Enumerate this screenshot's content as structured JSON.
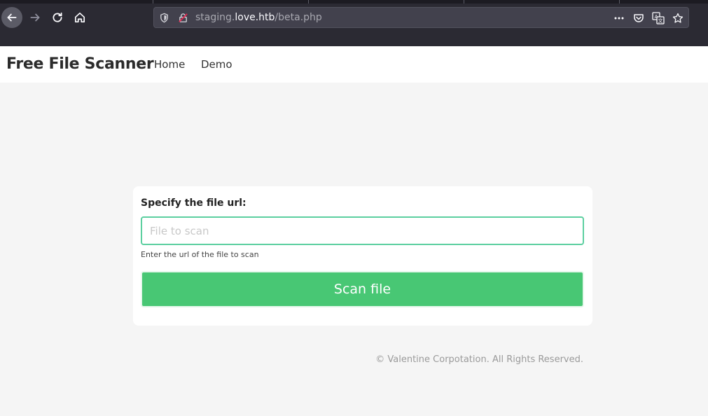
{
  "browser": {
    "url_scheme_part": "staging.",
    "url_host": "love.htb",
    "url_path": "/beta.php"
  },
  "site": {
    "brand": "Free File Scanner",
    "nav": [
      {
        "label": "Home"
      },
      {
        "label": "Demo"
      }
    ]
  },
  "form": {
    "label": "Specify the file url:",
    "input_placeholder": "File to scan",
    "input_value": "",
    "help_text": "Enter the url of the file to scan",
    "submit_label": "Scan file"
  },
  "footer": {
    "text": "© Valentine Corpotation. All Rights Reserved."
  },
  "colors": {
    "accent_green": "#48c774",
    "input_border": "#5ccfa0",
    "browser_dark": "#2b2a33"
  },
  "icons": {
    "back": "arrow-left-icon",
    "forward": "arrow-right-icon",
    "reload": "reload-icon",
    "home": "home-icon",
    "tracking": "shield-icon",
    "insecure": "insecure-lock-icon",
    "page_actions": "more-icon",
    "pocket": "pocket-icon",
    "translate": "translate-icon",
    "bookmark": "star-icon"
  }
}
